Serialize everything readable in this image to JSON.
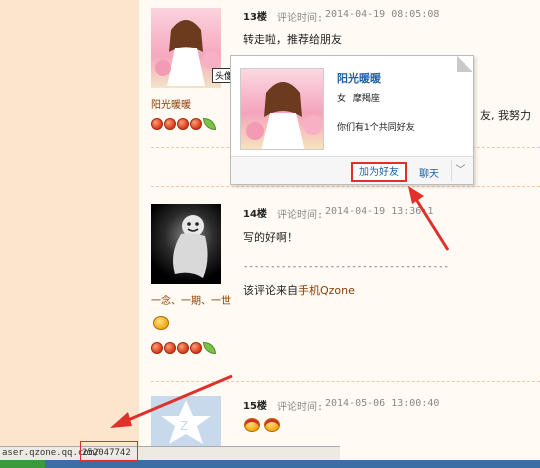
{
  "floors": [
    {
      "floor": "13楼",
      "time_label": "评论时间:",
      "time": "2014-04-19 08:05:08",
      "nickname": "阳光暖暖",
      "text": "转走啦，推荐给朋友"
    },
    {
      "floor": "14楼",
      "time_label": "评论时间:",
      "time": "2014-04-19 13:36:1",
      "nickname": "一念、一期、一世",
      "text": "写的好啊！",
      "separator": "--------------------------------------",
      "source_prefix": "该评论来自",
      "source_app": "手机Qzone"
    },
    {
      "floor": "15楼",
      "time_label": "评论时间:",
      "time": "2014-05-06 13:00:40"
    }
  ],
  "avatar_tag": "头像",
  "behind_text": "友, 我努力",
  "card": {
    "name": "阳光暖暖",
    "gender": "女",
    "sign": "摩羯座",
    "mutual": "你们有1个共同好友",
    "add_friend": "加为好友",
    "chat": "聊天",
    "more": "﹀"
  },
  "statusbar": {
    "url": "aser.qzone.qq.com/",
    "id": "252047742"
  },
  "colors": {
    "highlight_box": "#e0302a",
    "link": "#1b62a8",
    "nickname": "#8b3a00"
  }
}
